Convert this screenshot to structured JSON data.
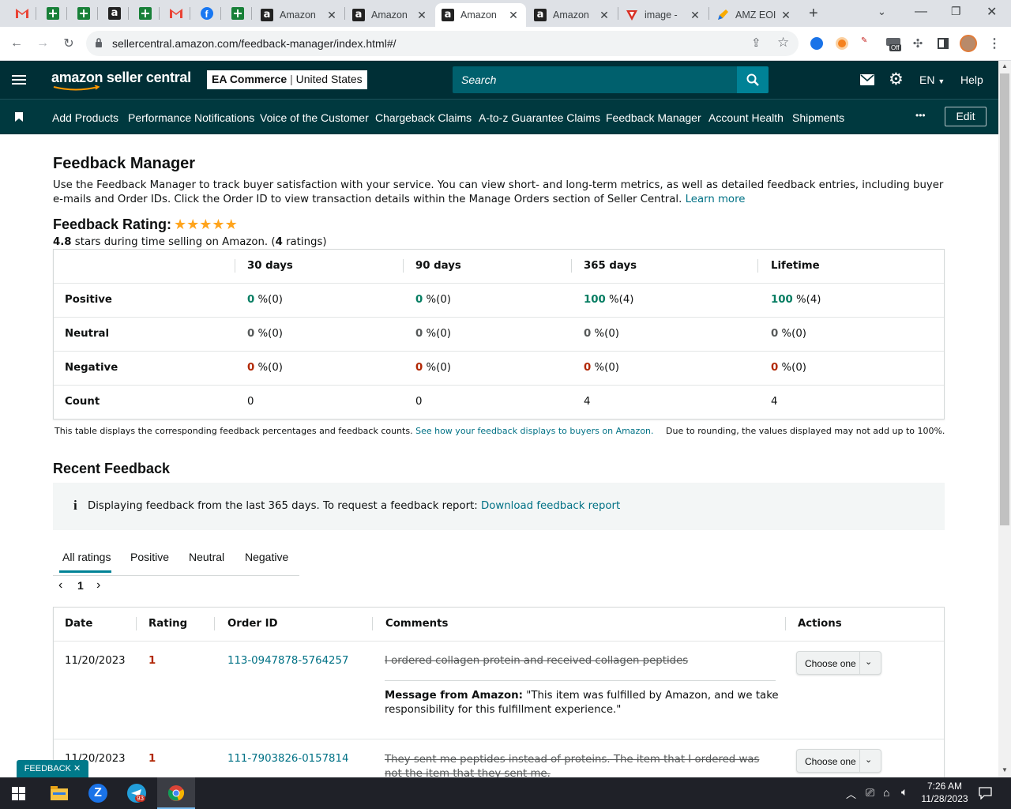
{
  "browser": {
    "tabs": [
      {
        "title": "Amazon",
        "active": false
      },
      {
        "title": "Amazon",
        "active": false
      },
      {
        "title": "Amazon",
        "active": true
      },
      {
        "title": "Amazon",
        "active": false
      },
      {
        "title": "image - ",
        "active": false
      },
      {
        "title": "AMZ EOI",
        "active": false
      }
    ],
    "url": "sellercentral.amazon.com/feedback-manager/index.html#/",
    "extension_badge": "Off"
  },
  "header": {
    "logo": "amazon seller central",
    "account_name": "EA Commerce",
    "account_region": "United States",
    "search_placeholder": "Search",
    "language": "EN",
    "help": "Help"
  },
  "nav": {
    "links": [
      "Add Products",
      "Performance Notifications",
      "Voice of the Customer",
      "Chargeback Claims",
      "A-to-z Guarantee Claims",
      "Feedback Manager",
      "Account Health",
      "Shipments"
    ],
    "more": "•••",
    "edit": "Edit"
  },
  "page": {
    "title": "Feedback Manager",
    "description": "Use the Feedback Manager to track buyer satisfaction with your service. You can view short- and long-term metrics, as well as detailed feedback entries, including buyer e-mails and Order IDs. Click the Order ID to view transaction details within the Manage Orders section of Seller Central.",
    "learn_more": "Learn more",
    "rating_label": "Feedback Rating:",
    "stars": 5,
    "rating_value": "4.8",
    "rating_text": "stars during time selling on Amazon. (",
    "rating_count": "4",
    "rating_count_suffix": "ratings)"
  },
  "summary": {
    "columns": [
      "30 days",
      "90 days",
      "365 days",
      "Lifetime"
    ],
    "rows": [
      {
        "label": "Positive",
        "values": [
          "0",
          "0",
          "100",
          "100"
        ],
        "counts": [
          "%(0)",
          "%(0)",
          "%(4)",
          "%(4)"
        ]
      },
      {
        "label": "Neutral",
        "values": [
          "0",
          "0",
          "0",
          "0"
        ],
        "counts": [
          "%(0)",
          "%(0)",
          "%(0)",
          "%(0)"
        ]
      },
      {
        "label": "Negative",
        "values": [
          "0",
          "0",
          "0",
          "0"
        ],
        "counts": [
          "%(0)",
          "%(0)",
          "%(0)",
          "%(0)"
        ]
      },
      {
        "label": "Count",
        "values": [
          "0",
          "0",
          "4",
          "4"
        ],
        "counts": [
          "",
          "",
          "",
          ""
        ]
      }
    ],
    "footnote": "This table displays the corresponding feedback percentages and feedback counts.",
    "footnote_link": "See how your feedback displays to buyers on Amazon.",
    "rounding_note": "Due to rounding, the values displayed may not add up to 100%."
  },
  "recent": {
    "title": "Recent Feedback",
    "info_text": "Displaying feedback from the last 365 days. To request a feedback report:",
    "info_link": "Download feedback report",
    "tabs": [
      "All ratings",
      "Positive",
      "Neutral",
      "Negative"
    ],
    "page": "1",
    "columns": [
      "Date",
      "Rating",
      "Order ID",
      "Comments",
      "Actions"
    ],
    "rows": [
      {
        "date": "11/20/2023",
        "rating": "1",
        "order_id": "113-0947878-5764257",
        "comment": "I ordered collagen protein and received collagen peptides",
        "message_label": "Message from Amazon:",
        "message": "\"This item was fulfilled by Amazon, and we take responsibility for this fulfillment experience.\"",
        "action": "Choose one"
      },
      {
        "date": "11/20/2023",
        "rating": "1",
        "order_id": "111-7903826-0157814",
        "comment": "They sent me peptides instead of proteins. The item that I ordered was not the item that they sent me.",
        "action": "Choose one"
      }
    ]
  },
  "feedback_tab": "FEEDBACK ✕",
  "taskbar": {
    "time": "7:26 AM",
    "date": "11/28/2023",
    "telegram_badge": "93"
  }
}
